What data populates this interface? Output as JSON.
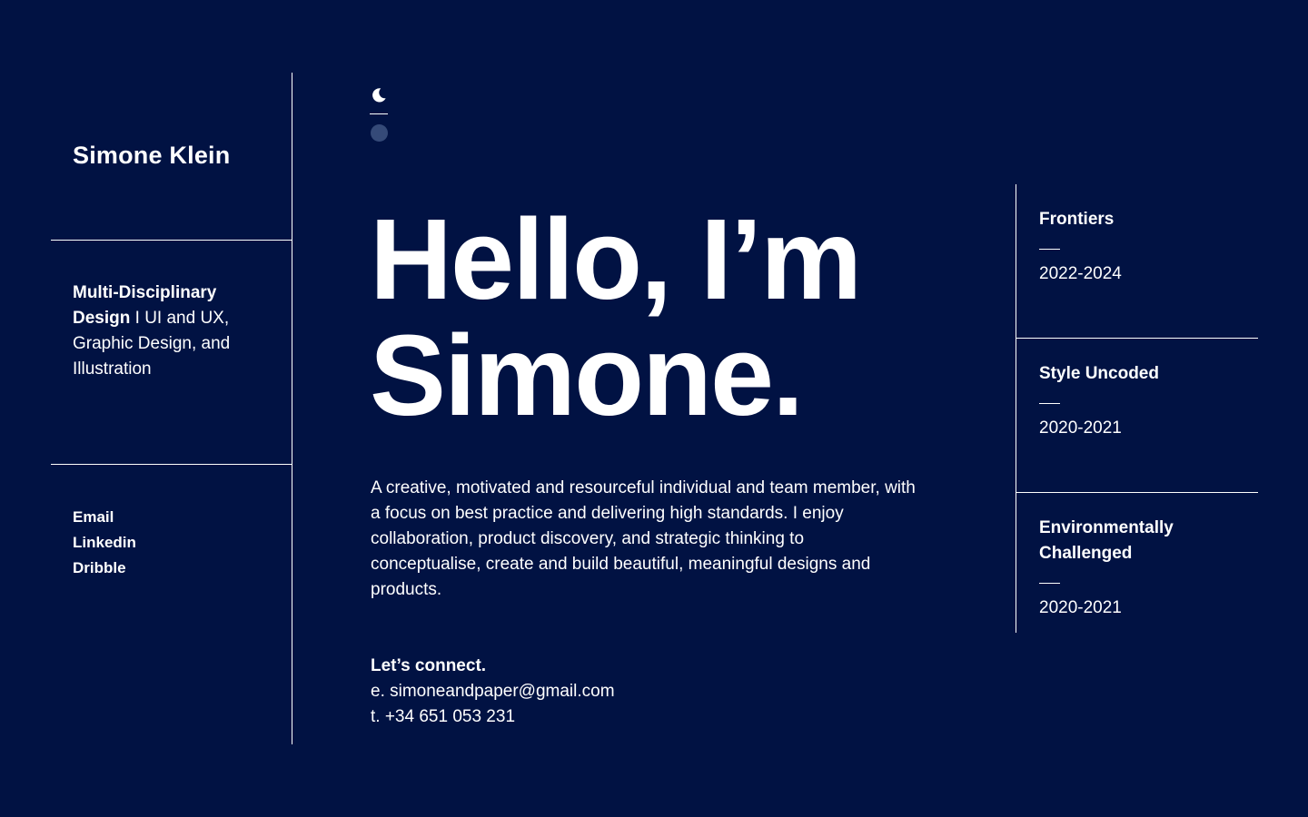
{
  "colors": {
    "background": "#011243",
    "text": "#ffffff",
    "toggle_dot": "#354a78"
  },
  "sidebar": {
    "name": "Simone Klein",
    "role": {
      "bold": "Multi-Disciplinary Design",
      "separator": " I ",
      "rest": "UI and UX, Graphic Design, and Illustration"
    },
    "links": [
      {
        "label": "Email"
      },
      {
        "label": "Linkedin"
      },
      {
        "label": "Dribble"
      }
    ]
  },
  "theme_toggle": {
    "icon": "moon-icon"
  },
  "hero": {
    "line1": "Hello, I’m",
    "line2": "Simone."
  },
  "intro": "A creative, motivated and resourceful individual and team member, with a focus on best practice and delivering high standards. I enjoy collaboration, product discovery, and strategic thinking to conceptualise, create and build beautiful, meaningful designs and products.",
  "connect": {
    "heading": "Let’s connect.",
    "email": "e. simoneandpaper@gmail.com",
    "phone": "t. +34 651 053 231"
  },
  "experience": [
    {
      "title": "Frontiers",
      "years": "2022-2024"
    },
    {
      "title": "Style Uncoded",
      "years": "2020-2021"
    },
    {
      "title": "Environmentally Challenged",
      "years": "2020-2021"
    }
  ]
}
